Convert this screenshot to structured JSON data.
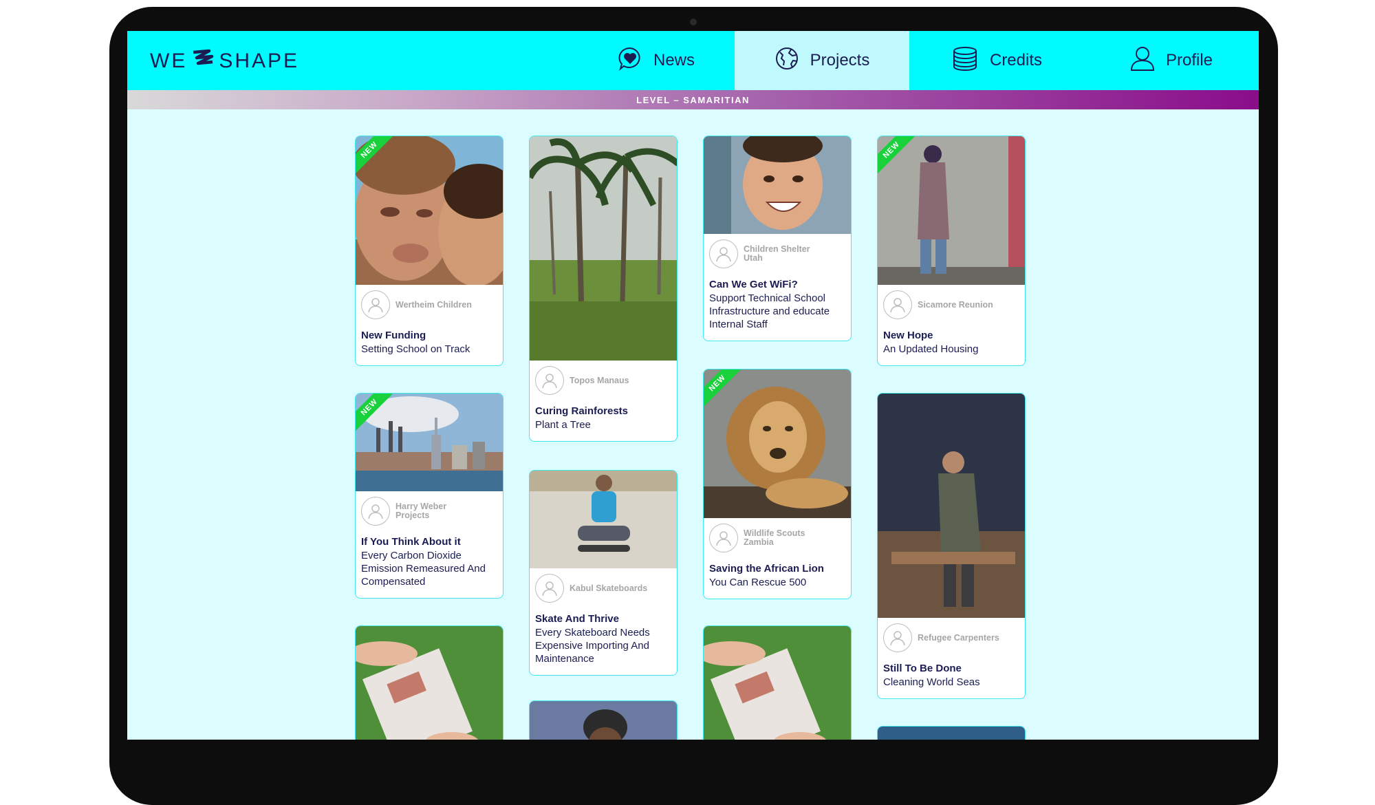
{
  "brand": {
    "left": "WE",
    "right": "SHAPE"
  },
  "nav": {
    "news": "News",
    "projects": "Projects",
    "credits": "Credits",
    "profile": "Profile",
    "active": "Projects"
  },
  "level": "LEVEL – SAMARITIAN",
  "badge": "NEW",
  "colors": {
    "header": "#00fbff",
    "active_tab": "#bff9fd",
    "background": "#dcfdff",
    "text": "#1b1d52",
    "new_badge": "#19d13a",
    "card_border": "#3fe9f1"
  },
  "cards": [
    {
      "org": "Wertheim Children",
      "title": "New Funding",
      "desc": "Setting School on Track",
      "is_new": true,
      "image": "boy-making-face-photo"
    },
    {
      "org": "Topos Manaus",
      "title": "Curing Rainforests",
      "desc": "Plant a Tree",
      "is_new": false,
      "image": "palm-trees-photo"
    },
    {
      "org": "Children Shelter Utah",
      "title": "Can We Get WiFi?",
      "desc": "Support Technical School Infrastructure and educate Internal Staff",
      "is_new": false,
      "image": "smiling-boy-photo"
    },
    {
      "org": "Sicamore Reunion",
      "title": "New Hope",
      "desc": "An Updated Housing",
      "is_new": true,
      "image": "man-by-wall-photo"
    },
    {
      "org": "Harry Weber Projects",
      "title": "If You Think About it",
      "desc": "Every Carbon Dioxide Emission Remeasured And Compensated",
      "is_new": true,
      "image": "city-skyline-photo"
    },
    {
      "org": "Kabul Skateboards",
      "title": "Skate And Thrive",
      "desc": "Every Skateboard Needs Expensive Importing And Maintenance",
      "is_new": false,
      "image": "boy-on-skateboard-photo"
    },
    {
      "org": "Wildlife Scouts Zambia",
      "title": "Saving the African Lion",
      "desc": "You Can Rescue 500",
      "is_new": true,
      "image": "lion-photo"
    },
    {
      "org": "Refugee Carpenters",
      "title": "Still To Be Done",
      "desc": "Cleaning World Seas",
      "is_new": false,
      "image": "carpenter-photo"
    }
  ]
}
